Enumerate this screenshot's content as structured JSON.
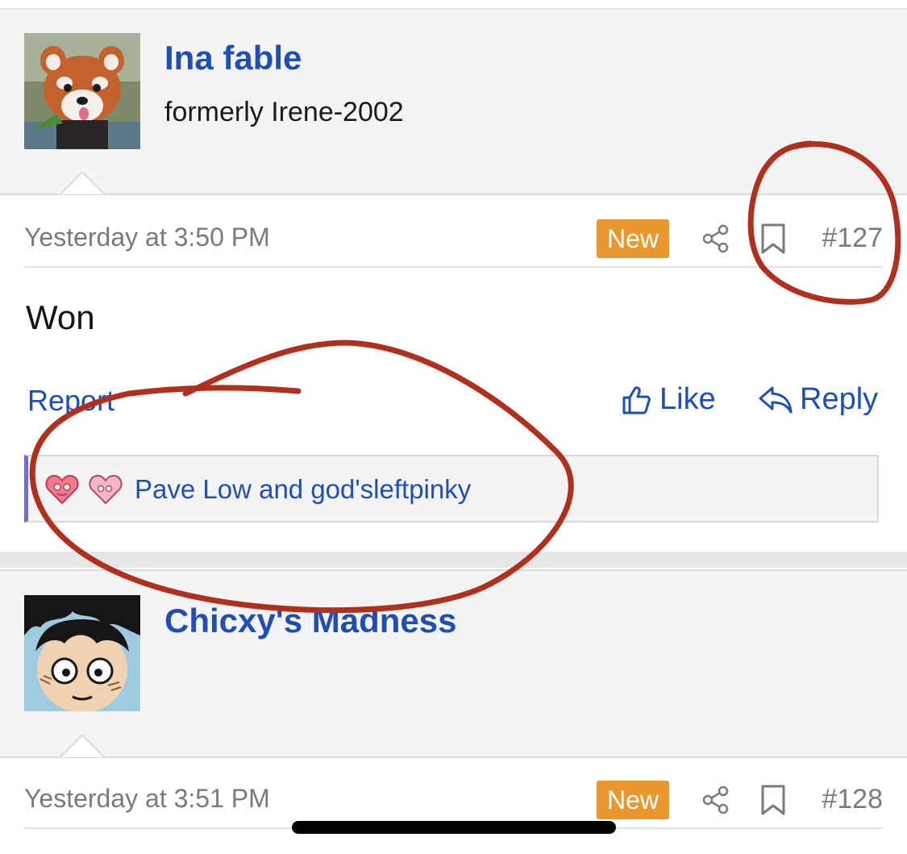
{
  "posts": [
    {
      "username": "Ina fable",
      "user_title": "formerly Irene-2002",
      "timestamp": "Yesterday at 3:50 PM",
      "badge": "New",
      "post_number": "#127",
      "body": "Won",
      "actions": {
        "report": "Report",
        "like": "Like",
        "reply": "Reply"
      },
      "reactions_text": "Pave Low and god'sleftpinky"
    },
    {
      "username": "Chicxy's Madness",
      "timestamp": "Yesterday at 3:51 PM",
      "badge": "New",
      "post_number": "#128"
    }
  ],
  "colors": {
    "link": "#1f4fb4",
    "badge": "#e8982e",
    "annotation": "#b0301e",
    "reaction_bar": "#6f6fd1"
  },
  "icons": [
    "share-icon",
    "bookmark-icon",
    "thumbs-up-icon",
    "reply-arrow-icon",
    "love-reaction-icon"
  ]
}
